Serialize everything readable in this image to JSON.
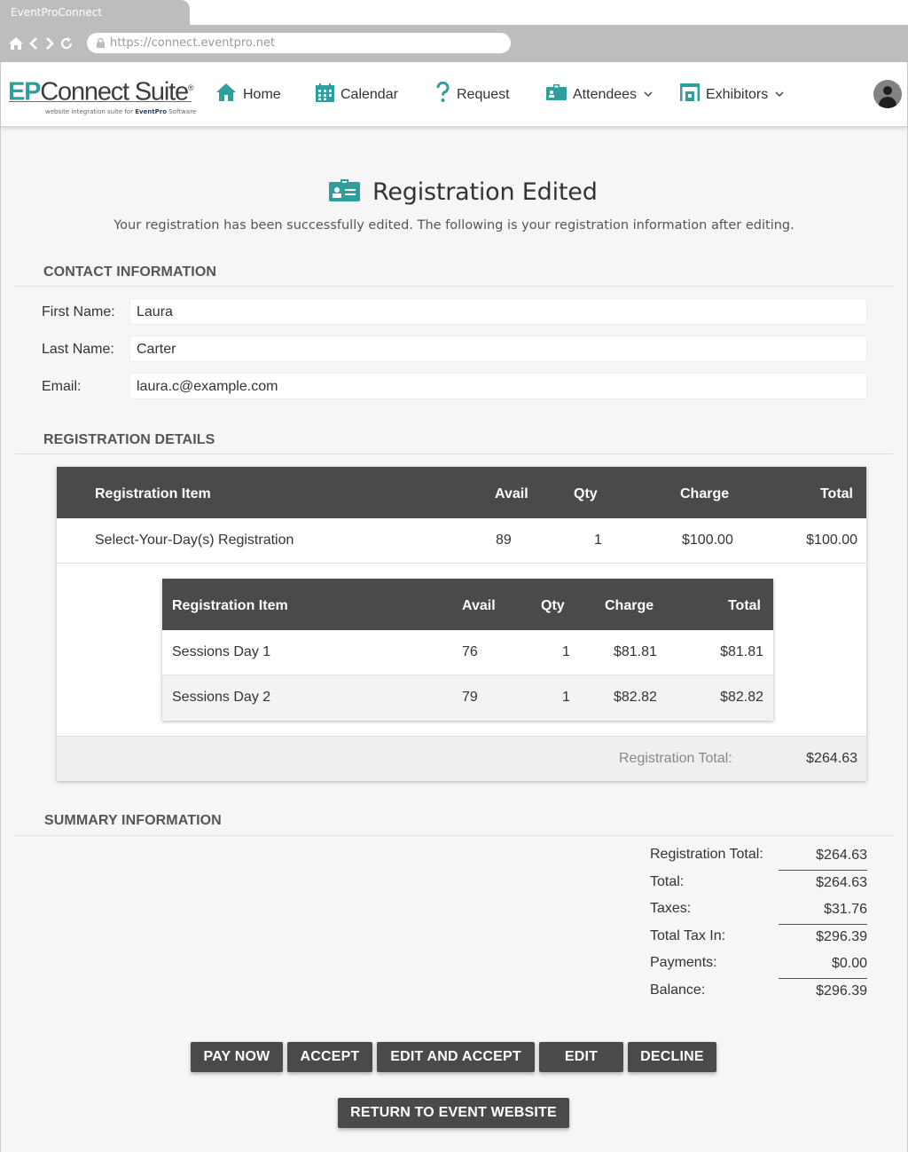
{
  "browser": {
    "tab_title": "EventProConnect",
    "url": "https://connect.eventpro.net"
  },
  "logo": {
    "brand_ep": "EP",
    "brand_rest": "Connect Suite",
    "registered": "®",
    "tagline_prefix": "website integration suite for ",
    "tagline_brand": "EventPro",
    "tagline_suffix": " Software"
  },
  "nav": {
    "home": "Home",
    "calendar": "Calendar",
    "request": "Request",
    "attendees": "Attendees",
    "exhibitors": "Exhibitors"
  },
  "page": {
    "title": "Registration Edited",
    "subtitle": "Your registration has been successfully edited. The following is your registration information after editing."
  },
  "contact": {
    "heading": "CONTACT INFORMATION",
    "first_name_label": "First Name:",
    "first_name": "Laura",
    "last_name_label": "Last Name:",
    "last_name": "Carter",
    "email_label": "Email:",
    "email": "laura.c@example.com"
  },
  "details": {
    "heading": "REGISTRATION DETAILS",
    "columns": {
      "item": "Registration Item",
      "avail": "Avail",
      "qty": "Qty",
      "charge": "Charge",
      "total": "Total"
    },
    "main_row": {
      "item": "Select-Your-Day(s) Registration",
      "avail": "89",
      "qty": "1",
      "charge": "$100.00",
      "total": "$100.00"
    },
    "sub_rows": [
      {
        "item": "Sessions Day 1",
        "avail": "76",
        "qty": "1",
        "charge": "$81.81",
        "total": "$81.81"
      },
      {
        "item": "Sessions Day 2",
        "avail": "79",
        "qty": "1",
        "charge": "$82.82",
        "total": "$82.82"
      }
    ],
    "footer_label": "Registration Total:",
    "footer_value": "$264.63"
  },
  "summary": {
    "heading": "SUMMARY INFORMATION",
    "rows": [
      {
        "label": "Registration Total:",
        "value": "$264.63"
      },
      {
        "label": "Total:",
        "value": "$264.63"
      },
      {
        "label": "Taxes:",
        "value": "$31.76"
      },
      {
        "label": "Total Tax In:",
        "value": "$296.39"
      },
      {
        "label": "Payments:",
        "value": "$0.00"
      },
      {
        "label": "Balance:",
        "value": "$296.39"
      }
    ]
  },
  "actions": {
    "pay_now": "PAY NOW",
    "accept": "ACCEPT",
    "edit_and_accept": "EDIT AND ACCEPT",
    "edit": "EDIT",
    "decline": "DECLINE",
    "return": "RETURN TO EVENT WEBSITE"
  },
  "colors": {
    "accent": "#2e9f9c",
    "header_dark": "#4a4a4a",
    "page_bg": "#f6f6f6",
    "chrome": "#bdbdbd"
  },
  "icons": {
    "home": "home-icon",
    "calendar": "calendar-icon",
    "request": "question-icon",
    "attendees": "badge-icon",
    "exhibitors": "booth-icon",
    "title": "id-card-icon",
    "avatar": "user-icon"
  }
}
